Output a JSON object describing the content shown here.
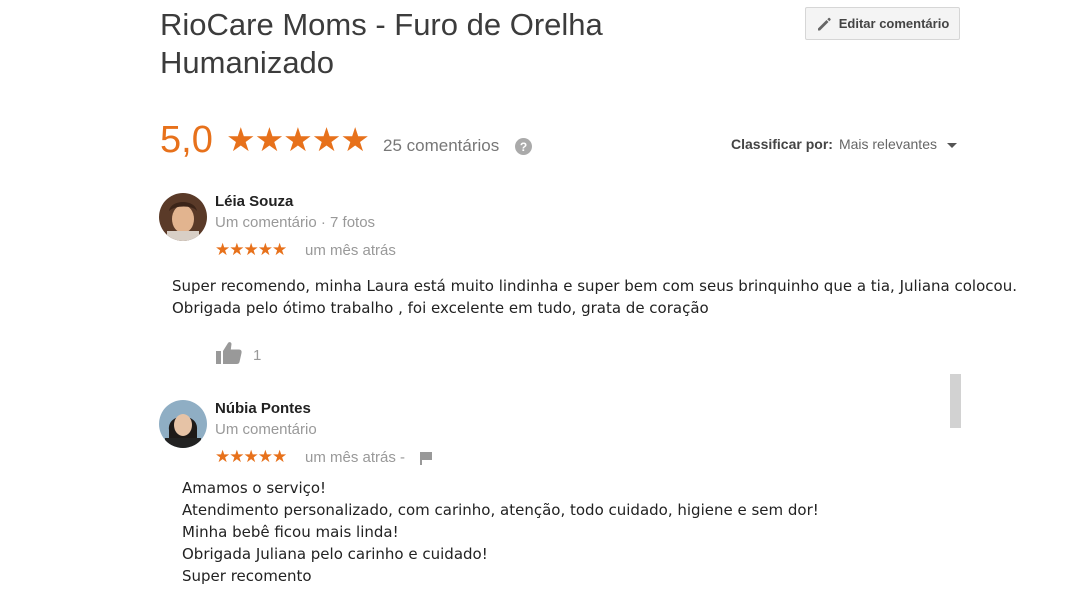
{
  "header": {
    "title": "RioCare Moms - Furo de Orelha Humanizado",
    "edit_button": "Editar comentário"
  },
  "summary": {
    "rating": "5,0",
    "stars": "★★★★★",
    "count": "25 comentários",
    "help": "?",
    "sort_label": "Classificar por:",
    "sort_value": "Mais relevantes"
  },
  "colors": {
    "accent": "#e7711b",
    "muted": "#999999"
  },
  "reviews": [
    {
      "author": "Léia Souza",
      "meta": "Um comentário · 7 fotos",
      "stars": "★★★★★",
      "rating": 5,
      "time": "um mês atrás",
      "text_lines": [
        "Super recomendo, minha Laura está muito lindinha e super bem com seus brinquinho que a tia, Juliana colocou.",
        "Obrigada pelo ótimo trabalho , foi excelente em tudo, grata de coração"
      ],
      "likes": "1"
    },
    {
      "author": "Núbia Pontes",
      "meta": "Um comentário",
      "stars": "★★★★★",
      "rating": 5,
      "time": "um mês atrás -",
      "text_lines": [
        "Amamos o serviço!",
        "Atendimento personalizado, com carinho, atenção, todo cuidado, higiene e sem dor!",
        "Minha bebê ficou mais linda!",
        "Obrigada Juliana pelo carinho e cuidado!",
        "Super recomento"
      ]
    }
  ]
}
